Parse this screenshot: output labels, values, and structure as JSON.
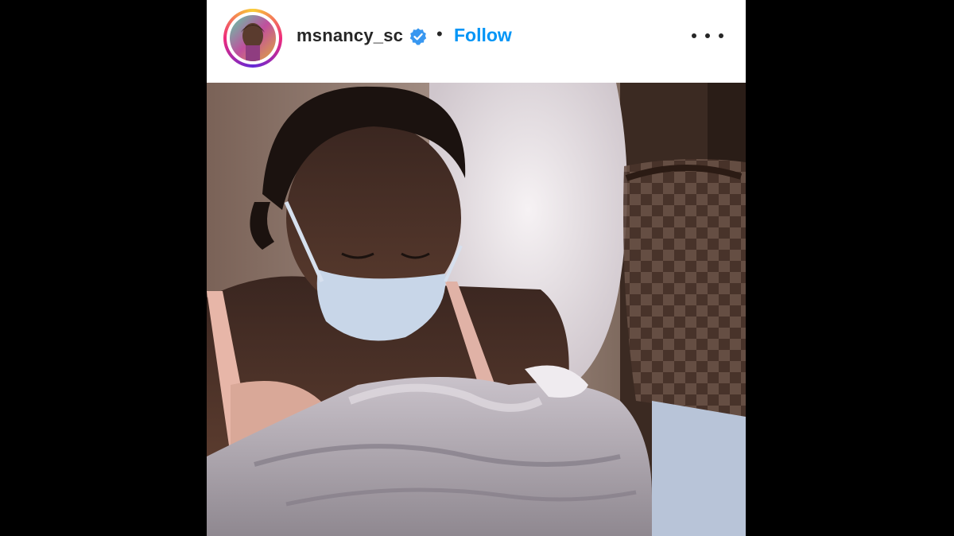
{
  "post": {
    "username": "msnancy_sc",
    "separator": "•",
    "follow_label": "Follow",
    "verified_icon": "verified-badge-icon",
    "more_icon": "more-options-icon",
    "colors": {
      "follow": "#0095f6",
      "verified": "#3897f0",
      "username": "#262626"
    }
  }
}
